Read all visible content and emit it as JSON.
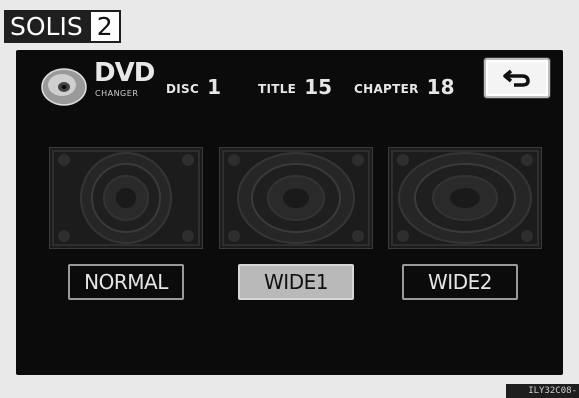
{
  "brand": {
    "name": "SOLIS",
    "number": "2"
  },
  "header": {
    "title": "DVD",
    "subtitle": "CHANGER",
    "disc_label": "DISC",
    "disc_value": "1",
    "title_label": "TITLE",
    "title_value": "15",
    "chapter_label": "CHAPTER",
    "chapter_value": "18",
    "back_icon": "return-arrow-icon"
  },
  "modes": [
    {
      "label": "NORMAL",
      "selected": false
    },
    {
      "label": "WIDE1",
      "selected": true
    },
    {
      "label": "WIDE2",
      "selected": false
    }
  ],
  "footer": {
    "code": "ILY32C08-"
  },
  "colors": {
    "screen": "#0b0b0b",
    "selected": "#b9b9b9",
    "text": "#e5e5e5"
  }
}
